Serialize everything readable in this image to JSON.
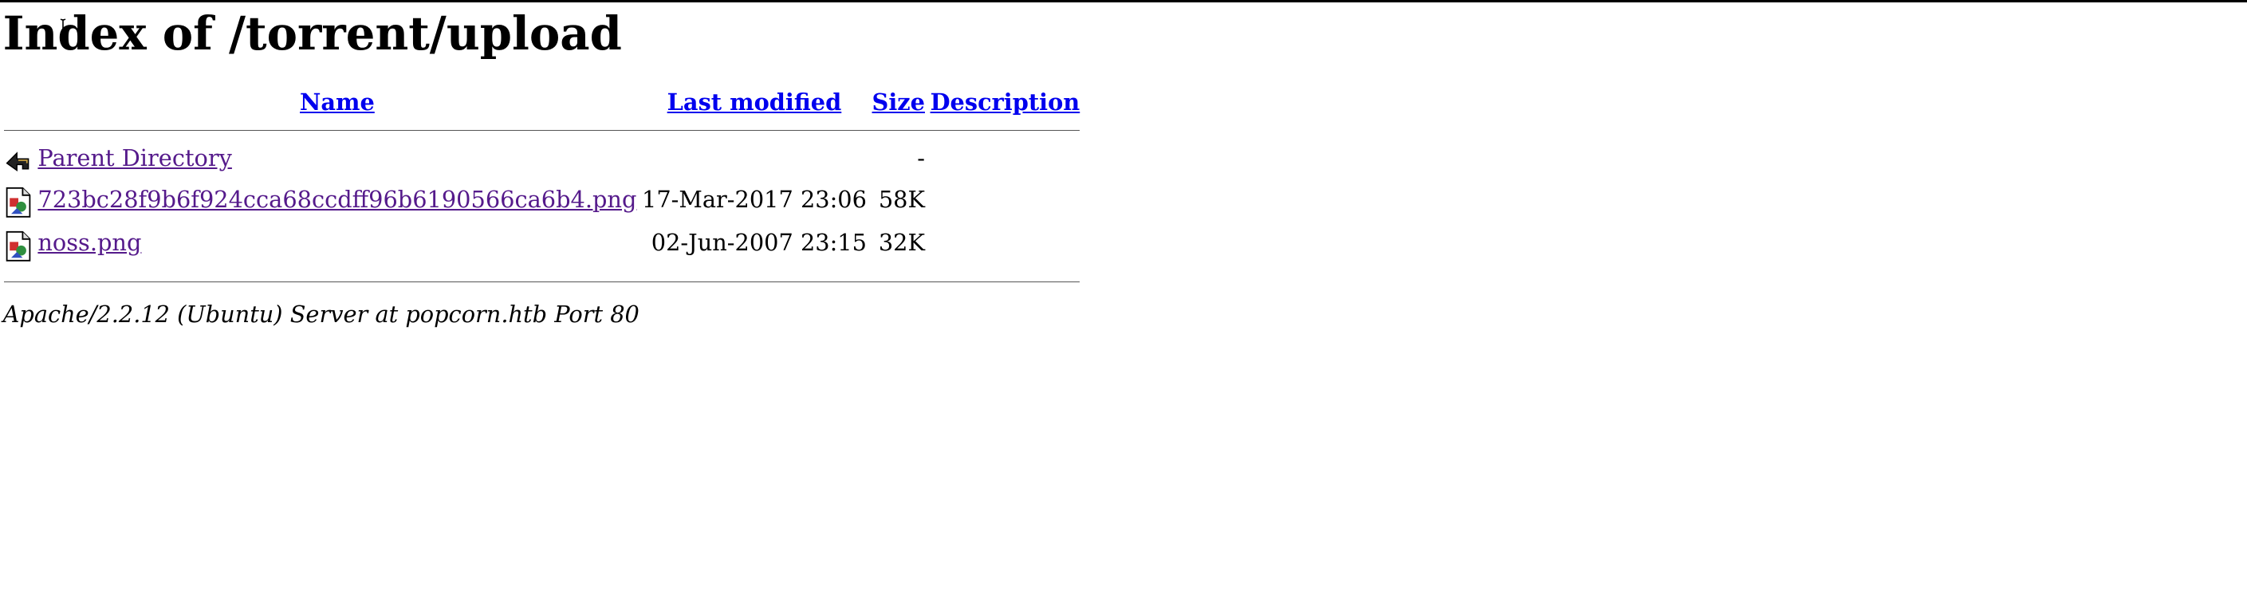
{
  "page": {
    "title": "Index of /torrent/upload"
  },
  "columns": {
    "name": "Name",
    "last_modified": "Last modified",
    "size": "Size",
    "description": "Description"
  },
  "rows": [
    {
      "icon": "back-arrow-icon",
      "name": "Parent Directory",
      "modified": "",
      "size": "-",
      "description": ""
    },
    {
      "icon": "image-file-icon",
      "name": "723bc28f9b6f924cca68ccdff96b6190566ca6b4.png",
      "modified": "17-Mar-2017 23:06",
      "size": "58K",
      "description": ""
    },
    {
      "icon": "image-file-icon",
      "name": "noss.png",
      "modified": "02-Jun-2007 23:15",
      "size": "32K",
      "description": ""
    }
  ],
  "footer": {
    "address": "Apache/2.2.12 (Ubuntu) Server at popcorn.htb Port 80"
  },
  "colors": {
    "header_link": "#0000ee",
    "visited_link": "#551a8b",
    "rule": "#555555"
  }
}
